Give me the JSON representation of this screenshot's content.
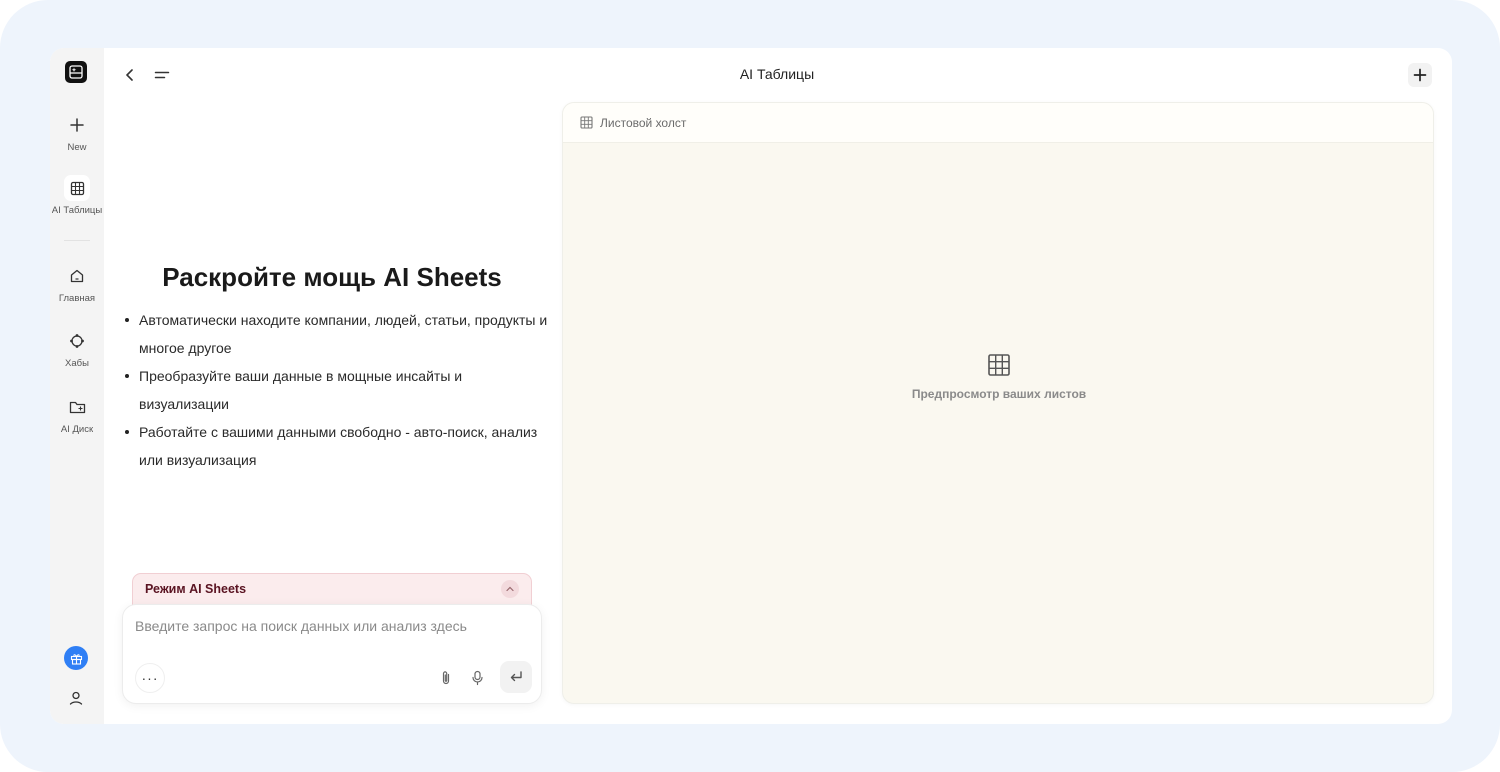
{
  "header": {
    "title": "AI Таблицы"
  },
  "sidebar": {
    "items": [
      {
        "label": "New",
        "icon": "plus-icon"
      },
      {
        "label": "AI Таблицы",
        "icon": "table-icon",
        "active": true
      },
      {
        "label": "Главная",
        "icon": "home-icon"
      },
      {
        "label": "Хабы",
        "icon": "hub-icon"
      },
      {
        "label": "AI Диск",
        "icon": "folder-icon"
      }
    ],
    "bottom": [
      {
        "icon": "gift-icon",
        "color": "#2f7ff5"
      },
      {
        "icon": "user-icon"
      }
    ]
  },
  "main": {
    "hero_title": "Раскройте мощь AI Sheets",
    "bullets": [
      "Автоматически находите компании, людей, статьи, продукты и многое другое",
      "Преобразуйте ваши данные в мощные инсайты и визуализации",
      "Работайте с вашими данными свободно - авто-поиск, анализ или визуализация"
    ],
    "mode_label": "Режим AI Sheets",
    "input": {
      "value": "",
      "placeholder": "Введите запрос на поиск данных или анализ здесь"
    },
    "more_label": "···"
  },
  "canvas": {
    "header_label": "Листовой холст",
    "preview_text": "Предпросмотр ваших листов",
    "background": "#faf8f0"
  },
  "colors": {
    "accent": "#2f7ff5",
    "mode_bg": "#fbeced",
    "mode_text": "#5a1422"
  }
}
